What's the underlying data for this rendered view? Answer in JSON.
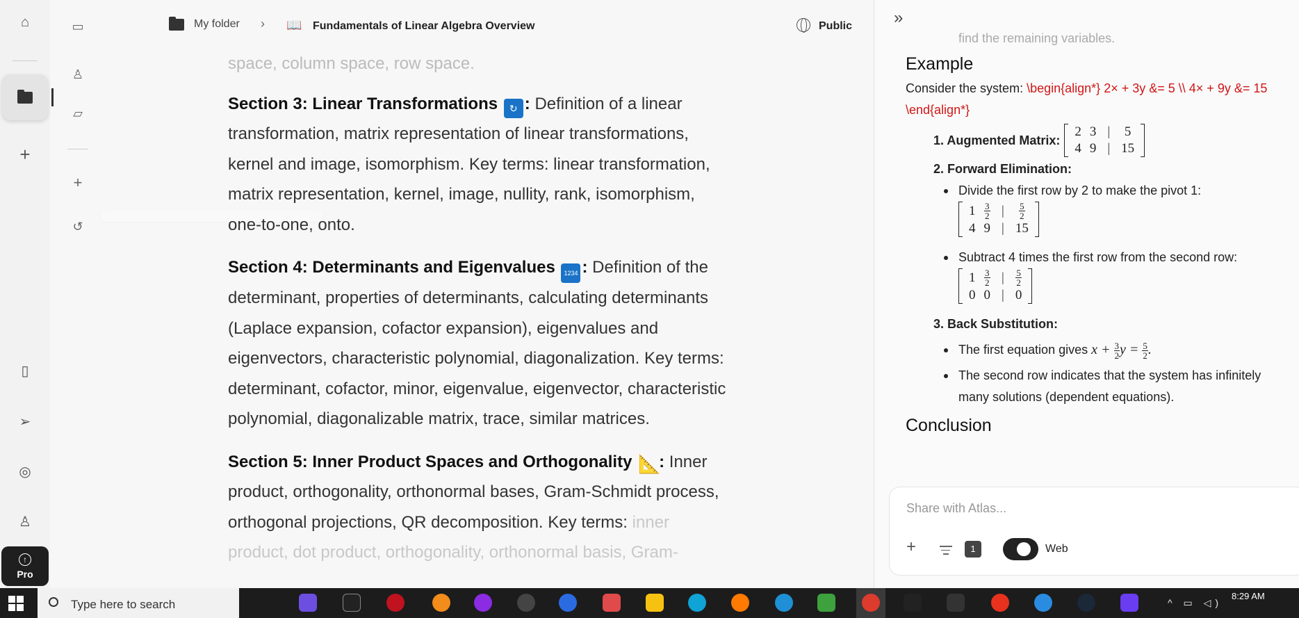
{
  "header": {
    "folder": "My folder",
    "title": "Fundamentals of Linear Algebra Overview",
    "visibility": "Public"
  },
  "doc": {
    "top_fade": "space, column space, row space.",
    "sections": [
      {
        "heading": "Section 3: Linear Transformations",
        "emoji": "🔄",
        "body": "Definition of a linear transformation, matrix representation of linear transformations, kernel and image, isomorphism. Key terms: linear transformation, matrix representation, kernel, image, nullity, rank, isomorphism, one-to-one, onto."
      },
      {
        "heading": "Section 4: Determinants and Eigenvalues",
        "emoji": "🔢",
        "body": "Definition of the determinant, properties of determinants, calculating determinants (Laplace expansion, cofactor expansion), eigenvalues and eigenvectors, characteristic polynomial, diagonalization. Key terms: determinant, cofactor, minor, eigenvalue, eigenvector, characteristic polynomial, diagonalizable matrix, trace, similar matrices."
      },
      {
        "heading": "Section 5: Inner Product Spaces and Orthogonality",
        "emoji": "📐",
        "body": "Inner product, orthogonality, orthonormal bases, Gram-Schmidt process, orthogonal projections, QR decomposition. Key terms:",
        "body_fade": "inner product, dot product, orthogonality, orthonormal basis, Gram-"
      }
    ]
  },
  "panel": {
    "top_fade": "find the remaining variables.",
    "example_heading": "Example",
    "consider_prefix": "Consider the system:",
    "consider_latex": "\\begin{align*} 2× + 3y &= 5 \\\\ 4× + 9y &= 15 \\end{align*}",
    "step1_label": "1. Augmented Matrix:",
    "matrix1": [
      [
        "2",
        "3",
        "|",
        "5"
      ],
      [
        "4",
        "9",
        "|",
        "15"
      ]
    ],
    "step2_label": "2. Forward Elimination:",
    "bullet_divide": "Divide the first row by 2 to make the pivot 1:",
    "bullet_subtract": "Subtract 4 times the first row from the second row:",
    "step3_label": "3. Back Substitution:",
    "bullet_first_eq_prefix": "The first equation gives",
    "bullet_second_row": "The second row indicates that the system has infinitely many solutions (dependent equations).",
    "conclusion_heading": "Conclusion"
  },
  "chat": {
    "placeholder": "Share with Atlas...",
    "badge": "1",
    "web_label": "Web"
  },
  "sidebar": {
    "pro_label": "Pro"
  },
  "taskbar": {
    "search_placeholder": "Type here to search",
    "time": "8:29 AM"
  }
}
